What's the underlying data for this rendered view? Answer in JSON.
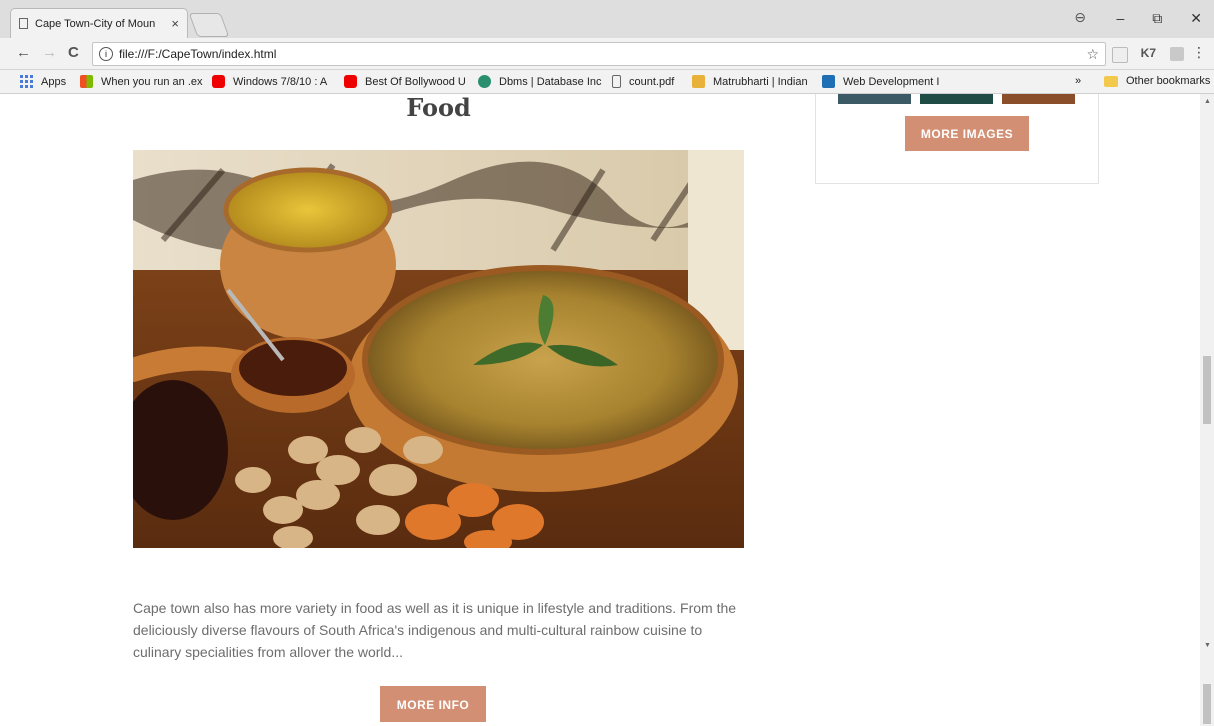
{
  "browser": {
    "tab_title": "Cape Town-City of Moun",
    "tab_close": "×",
    "url": "file:///F:/CapeTown/index.html",
    "nav": {
      "back": "←",
      "forward": "→",
      "reload": "C"
    },
    "star": "☆",
    "profile": "⊖",
    "window": {
      "minimize": "–",
      "restore": "⧉",
      "close": "✕"
    },
    "ext_badge": "K7",
    "menu": "⋮"
  },
  "bookmarks": {
    "apps": "Apps",
    "items": [
      {
        "label": "When you run an .ex",
        "color": "#f25022"
      },
      {
        "label": "Windows 7/8/10 : A",
        "color": "#ff0000"
      },
      {
        "label": "Best Of Bollywood U",
        "color": "#ff0000"
      },
      {
        "label": "Dbms | Database Inc",
        "color": "#2a8f6e"
      },
      {
        "label": "count.pdf",
        "color": "#ffffff"
      },
      {
        "label": "Matrubharti | Indian",
        "color": "#e8b13a"
      },
      {
        "label": "Web Development I",
        "color": "#1f6fb5"
      }
    ],
    "overflow": "»",
    "other": "Other bookmarks"
  },
  "page": {
    "section_title": "Food",
    "body": "Cape town also has more variety in food as well as it is unique in lifestyle and traditions. From the deliciously diverse flavours of South Africa's indigenous and multi-cultural rainbow cuisine to culinary specialities from allover the world...",
    "more_info": "MORE INFO",
    "more_images": "MORE IMAGES"
  },
  "colors": {
    "accent": "#d28f73"
  }
}
